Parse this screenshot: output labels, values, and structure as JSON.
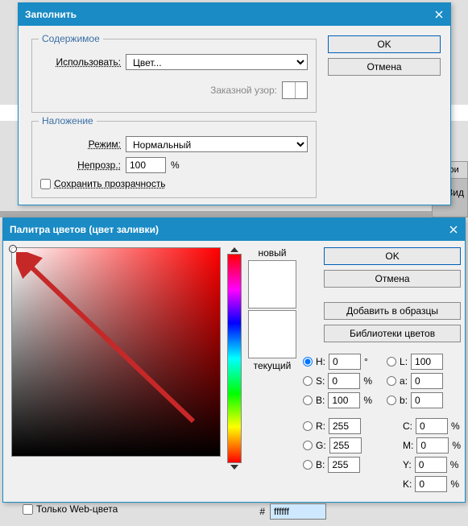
{
  "fill": {
    "title": "Заполнить",
    "group_content": "Содержимое",
    "use_label": "Использовать:",
    "use_value": "Цвет...",
    "custom_pattern_label": "Заказной узор:",
    "group_blend": "Наложение",
    "mode_label": "Режим:",
    "mode_value": "Нормальный",
    "opacity_label": "Непрозр.:",
    "opacity_value": "100",
    "opacity_unit": "%",
    "preserve_label": "Сохранить прозрачность",
    "ok": "OK",
    "cancel": "Отмена"
  },
  "side": {
    "tab": "Слои",
    "row": "Вид"
  },
  "picker": {
    "title": "Палитра цветов (цвет заливки)",
    "new": "новый",
    "current": "текущий",
    "ok": "OK",
    "cancel": "Отмена",
    "add": "Добавить в образцы",
    "libs": "Библиотеки цветов",
    "H": "H:",
    "H_v": "0",
    "H_u": "°",
    "S": "S:",
    "S_v": "0",
    "S_u": "%",
    "Bv": "B:",
    "Bv_v": "100",
    "Bv_u": "%",
    "R": "R:",
    "R_v": "255",
    "G": "G:",
    "G_v": "255",
    "B": "B:",
    "B_v": "255",
    "L": "L:",
    "L_v": "100",
    "a": "a:",
    "a_v": "0",
    "b": "b:",
    "b_v": "0",
    "C": "C:",
    "C_v": "0",
    "pct": "%",
    "M": "M:",
    "M_v": "0",
    "Y": "Y:",
    "Y_v": "0",
    "K": "K:",
    "K_v": "0",
    "hex_label": "#",
    "hex": "ffffff",
    "webonly": "Только Web-цвета"
  }
}
